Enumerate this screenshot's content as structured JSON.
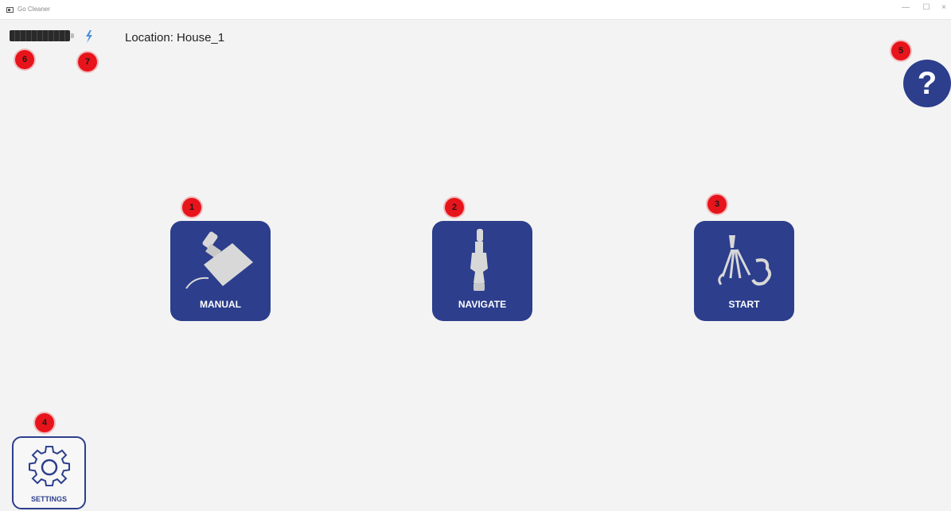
{
  "window": {
    "title": "Go Cleaner",
    "controls": {
      "minimize": "—",
      "maximize": "☐",
      "close": "×"
    }
  },
  "status": {
    "battery_icon": "battery-icon",
    "wifi_icon": "wifi-icon",
    "location": "Location: House_1"
  },
  "markers": [
    "1",
    "2",
    "3",
    "4",
    "5",
    "6",
    "7"
  ],
  "help": {
    "label": "?",
    "icon": "help-icon"
  },
  "tiles": [
    {
      "label": "MANUAL",
      "icon": "vacuum-head-icon"
    },
    {
      "label": "NAVIGATE",
      "icon": "vacuum-upright-icon"
    },
    {
      "label": "START",
      "icon": "spray-clean-icon"
    }
  ],
  "settings": {
    "label": "SETTINGS",
    "icon": "gear-icon"
  },
  "colors": {
    "primary": "#2c3e8c",
    "marker": "#e8141b",
    "background": "#f3f3f3"
  }
}
